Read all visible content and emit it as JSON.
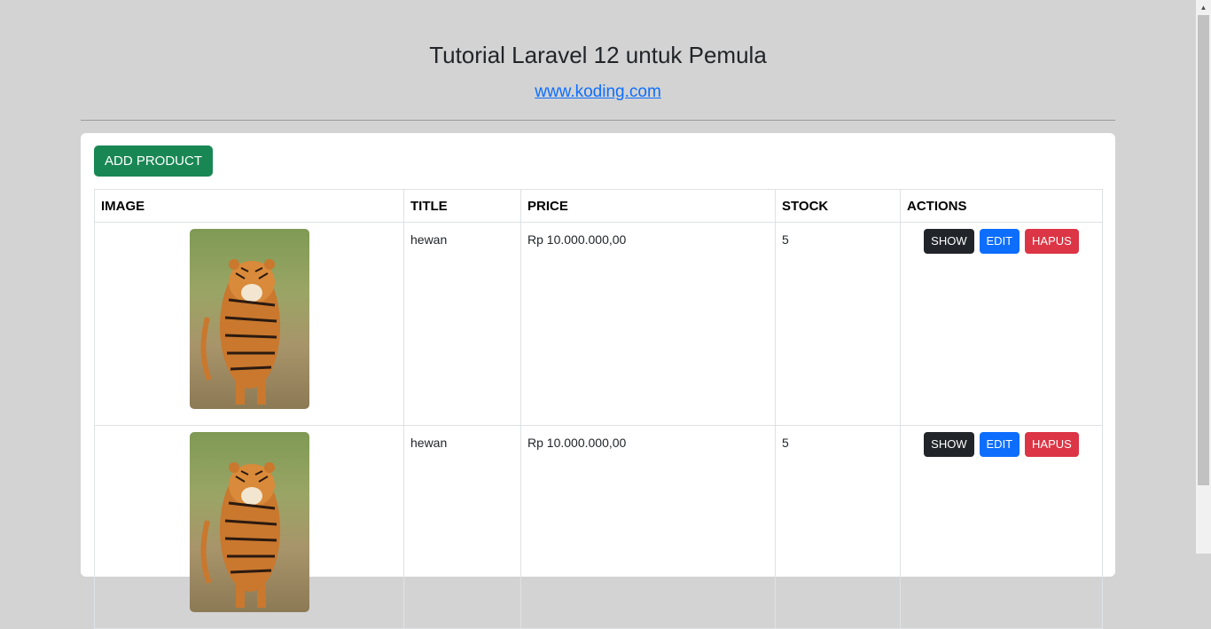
{
  "header": {
    "title": "Tutorial Laravel 12 untuk Pemula",
    "link_text": "www.koding.com"
  },
  "toolbar": {
    "add_label": "ADD PRODUCT"
  },
  "table": {
    "columns": [
      "IMAGE",
      "TITLE",
      "PRICE",
      "STOCK",
      "ACTIONS"
    ],
    "rows": [
      {
        "title": "hewan",
        "price": "Rp 10.000.000,00",
        "stock": "5"
      },
      {
        "title": "hewan",
        "price": "Rp 10.000.000,00",
        "stock": "5"
      }
    ],
    "actions": {
      "show": "SHOW",
      "edit": "EDIT",
      "delete": "HAPUS"
    }
  },
  "colors": {
    "add": "#198754",
    "show": "#212529",
    "edit": "#0d6efd",
    "delete": "#dc3545"
  }
}
